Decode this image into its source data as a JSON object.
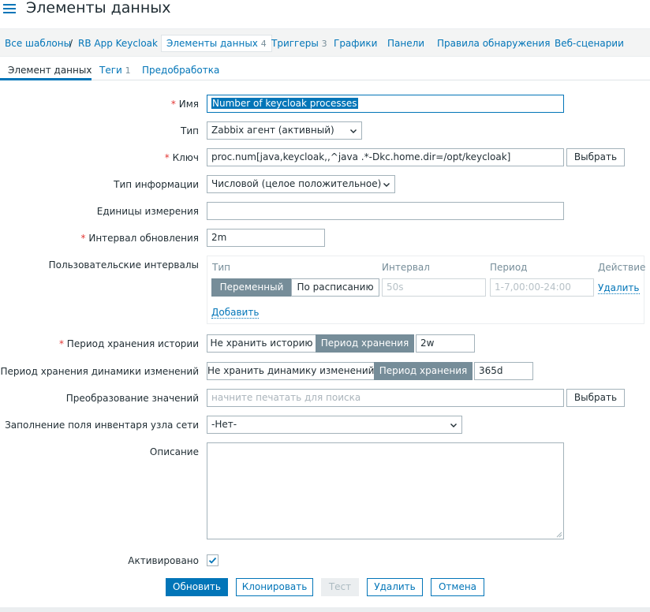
{
  "header": {
    "title": "Элементы данных"
  },
  "breadcrumbs": {
    "all_templates": "Все шаблоны",
    "separator": "/",
    "template": "RB App Keycloak",
    "items": {
      "label": "Элементы данных",
      "count": "4"
    },
    "triggers": {
      "label": "Триггеры",
      "count": "3"
    },
    "graphs": "Графики",
    "dashboards": "Панели",
    "discovery": "Правила обнаружения",
    "web": "Веб-сценарии"
  },
  "tabs": {
    "item": "Элемент данных",
    "tags": {
      "label": "Теги",
      "count": "1"
    },
    "preprocessing": "Предобработка"
  },
  "form": {
    "name": {
      "label": "Имя",
      "value": "Number of keycloak processes"
    },
    "type": {
      "label": "Тип",
      "value": "Zabbix агент (активный)"
    },
    "key": {
      "label": "Ключ",
      "value": "proc.num[java,keycloak,,^java .*-Dkc.home.dir=/opt/keycloak]",
      "select_button": "Выбрать"
    },
    "value_type": {
      "label": "Тип информации",
      "value": "Числовой (целое положительное)"
    },
    "units": {
      "label": "Единицы измерения",
      "value": ""
    },
    "delay": {
      "label": "Интервал обновления",
      "value": "2m"
    },
    "custom_intervals": {
      "label": "Пользовательские интервалы",
      "col_type": "Тип",
      "col_interval": "Интервал",
      "col_period": "Период",
      "col_action": "Действие",
      "flexible": "Переменный",
      "scheduling": "По расписанию",
      "interval_placeholder": "50s",
      "period_placeholder": "1-7,00:00-24:00",
      "remove": "Удалить",
      "add": "Добавить"
    },
    "history": {
      "label": "Период хранения истории",
      "no_keep": "Не хранить историю",
      "keep": "Период хранения",
      "value": "2w"
    },
    "trends": {
      "label": "Период хранения динамики изменений",
      "no_keep": "Не хранить динамику изменений",
      "keep": "Период хранения",
      "value": "365d"
    },
    "valuemap": {
      "label": "Преобразование значений",
      "placeholder": "начните печатать для поиска",
      "select_button": "Выбрать"
    },
    "inventory": {
      "label": "Заполнение поля инвентаря узла сети",
      "value": "-Нет-"
    },
    "description": {
      "label": "Описание",
      "value": ""
    },
    "enabled": {
      "label": "Активировано",
      "checked": true
    }
  },
  "actions": {
    "update": "Обновить",
    "clone": "Клонировать",
    "test": "Тест",
    "delete": "Удалить",
    "cancel": "Отмена"
  },
  "colors": {
    "accent": "#0275b8",
    "required": "#e33734",
    "segment_on": "#768d99"
  }
}
